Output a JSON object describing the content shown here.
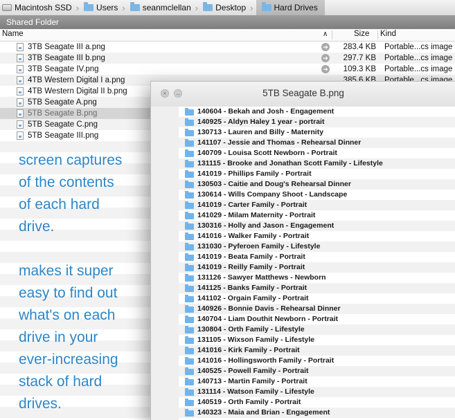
{
  "breadcrumb": [
    {
      "label": "Macintosh SSD",
      "icon": "drive-icon"
    },
    {
      "label": "Users",
      "icon": "folder-icon"
    },
    {
      "label": "seanmclellan",
      "icon": "folder-icon"
    },
    {
      "label": "Desktop",
      "icon": "folder-icon"
    },
    {
      "label": "Hard Drives",
      "icon": "folder-icon"
    }
  ],
  "shared_folder": "Shared Folder",
  "columns": {
    "name": "Name",
    "size": "Size",
    "kind": "Kind"
  },
  "files": [
    {
      "name": "3TB Seagate III a.png",
      "size": "283.4 KB",
      "kind": "Portable...cs image"
    },
    {
      "name": "3TB Seagate III b.png",
      "size": "297.7 KB",
      "kind": "Portable...cs image"
    },
    {
      "name": "3TB Seagate IV.png",
      "size": "109.3 KB",
      "kind": "Portable...cs image"
    },
    {
      "name": "4TB Western Digital I a.png",
      "size": "385.6 KB",
      "kind": "Portable...cs image"
    },
    {
      "name": "4TB Western Digital II b.png",
      "size": "",
      "kind": ""
    },
    {
      "name": "5TB Seagate A.png",
      "size": "",
      "kind": ""
    },
    {
      "name": "5TB Seagate B.png",
      "size": "",
      "kind": ""
    },
    {
      "name": "5TB Seagate C.png",
      "size": "",
      "kind": ""
    },
    {
      "name": "5TB Seagate III.png",
      "size": "",
      "kind": ""
    }
  ],
  "caption": {
    "para1": [
      "screen captures",
      "of the contents",
      "of each hard",
      "drive."
    ],
    "para2": [
      "makes it super",
      "easy to find out",
      "what's on each",
      "drive in your",
      "ever-increasing",
      "stack of hard",
      "drives."
    ]
  },
  "preview": {
    "title": "5TB Seagate B.png",
    "folders": [
      "140604 - Bekah and Josh - Engagement",
      "140925 - Aldyn Haley 1 year - portrait",
      "130713 - Lauren and Billy - Maternity",
      "141107 - Jessie and Thomas - Rehearsal Dinner",
      "140709 - Louisa Scott Newborn - Portrait",
      "131115 - Brooke and Jonathan Scott Family - Lifestyle",
      "141019 - Phillips Family - Portrait",
      "130503 - Caitie and Doug's Rehearsal Dinner",
      "130614 - Wills Company Shoot - Landscape",
      "141019 - Carter Family - Portrait",
      "141029 - Milam Maternity - Portrait",
      "130316 - Holly and Jason - Engagement",
      "141016 - Walker Family - Portrait",
      "131030 - Pyferoen Family - Lifestyle",
      "141019 - Beata Family - Portrait",
      "141019 - Reilly Family - Portrait",
      "131126 - Sawyer Matthews - Newborn",
      "141125 - Banks Family - Portrait",
      "141102 - Orgain Family - Portrait",
      "140926 - Bonnie Davis - Rehearsal Dinner",
      "140704 - Liam Douthit Newborn - Portrait",
      "130804 - Orth Family - Lifestyle",
      "131105 - Wixson Family - Lifestyle",
      "141016 - Kirk Family - Portrait",
      "141016 - Hollingsworth Family - Portrait",
      "140525 - Powell Family - Portrait",
      "140713 - Martin Family - Portrait",
      "131114 - Watson Family - Lifestyle",
      "140519 - Orth Family - Portrait",
      "140323 - Maia and Brian - Engagement"
    ]
  }
}
